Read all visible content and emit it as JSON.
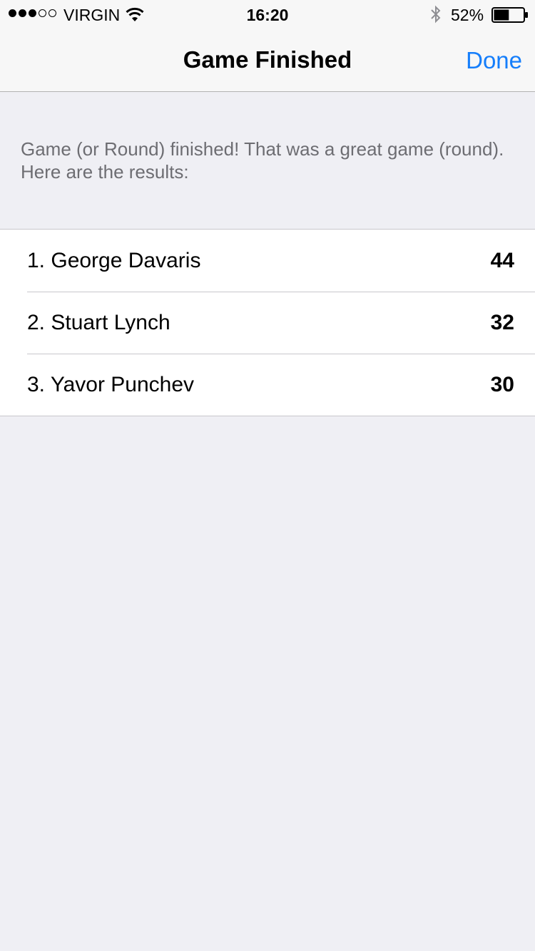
{
  "status_bar": {
    "carrier": "VIRGIN",
    "time": "16:20",
    "battery": "52%",
    "battery_level": 0.52,
    "signal_bars": 3,
    "signal_total": 5,
    "icons": [
      "signal-dots",
      "wifi-icon",
      "bluetooth-icon",
      "battery-icon"
    ]
  },
  "nav": {
    "title": "Game Finished",
    "done_label": "Done",
    "accent_color": "#157efb"
  },
  "header": {
    "message": "Game (or Round) finished! That was a great game (round). Here are the results:"
  },
  "results": [
    {
      "label": "1. George Davaris",
      "score": "44"
    },
    {
      "label": "2. Stuart Lynch",
      "score": "32"
    },
    {
      "label": "3. Yavor Punchev",
      "score": "30"
    }
  ]
}
